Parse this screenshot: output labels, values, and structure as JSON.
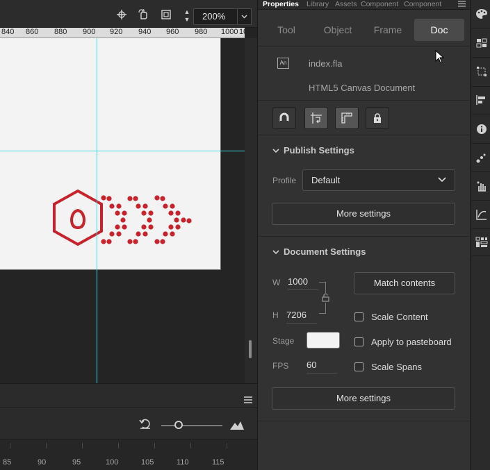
{
  "stage": {
    "zoom": "200%",
    "ruler_labels": [
      "840",
      "860",
      "880",
      "900",
      "920",
      "940",
      "960",
      "980",
      "1000",
      "10"
    ]
  },
  "timeline": {
    "frame_labels": [
      "85",
      "90",
      "95",
      "100",
      "105",
      "110",
      "115"
    ]
  },
  "panel_tabs": [
    "Properties",
    "Library",
    "Assets",
    "Component",
    "Component"
  ],
  "property_modes": [
    "Tool",
    "Object",
    "Frame",
    "Doc"
  ],
  "active_mode": "Doc",
  "document": {
    "icon_text": "An",
    "filename": "index.fla",
    "type": "HTML5 Canvas Document"
  },
  "publish_settings": {
    "title": "Publish Settings",
    "profile_label": "Profile",
    "profile_value": "Default",
    "more_settings": "More settings"
  },
  "document_settings": {
    "title": "Document Settings",
    "w_label": "W",
    "w_value": "1000",
    "h_label": "H",
    "h_value": "7206",
    "match_contents": "Match contents",
    "stage_label": "Stage",
    "stage_color": "#f2f3f2",
    "fps_label": "FPS",
    "fps_value": "60",
    "scale_content": "Scale Content",
    "apply_to_pasteboard": "Apply to pasteboard",
    "scale_spans": "Scale Spans",
    "more_settings": "More settings"
  },
  "colors": {
    "guide": "#3fd9e6",
    "logo_red": "#c8232c"
  }
}
